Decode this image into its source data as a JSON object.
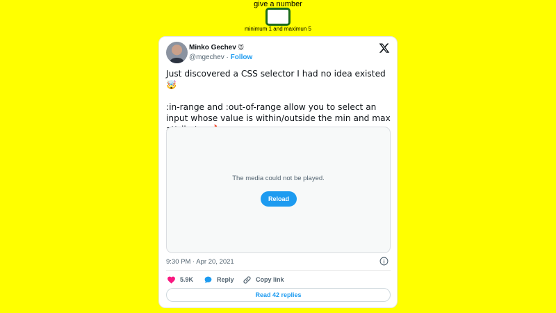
{
  "form": {
    "label": "give a number",
    "input_value": "",
    "hint": "minimum 1 and maximun 5"
  },
  "tweet": {
    "author_name": "Minko Gechev",
    "author_badge": "🐭",
    "handle": "@mgechev",
    "separator": " · ",
    "follow_label": "Follow",
    "text": "Just discovered a CSS selector I had no idea existed 🤯\n\n:in-range and :out-of-range allow you to select an input whose value is within/outside the min and max attributes 🔥",
    "media_message": "The media could not be played.",
    "reload_label": "Reload",
    "timestamp": "9:30 PM · Apr 20, 2021",
    "likes": "5.9K",
    "reply_label": "Reply",
    "copy_link_label": "Copy link",
    "read_replies_label": "Read 42 replies"
  },
  "colors": {
    "page_background": "#ffff00",
    "input_border": "#1a6a1a",
    "accent": "#1d9bf0",
    "like": "#f91880",
    "muted_text": "#536471"
  },
  "icons": [
    "x-logo-icon",
    "heart-icon",
    "reply-bubble-icon",
    "link-icon",
    "info-icon"
  ]
}
